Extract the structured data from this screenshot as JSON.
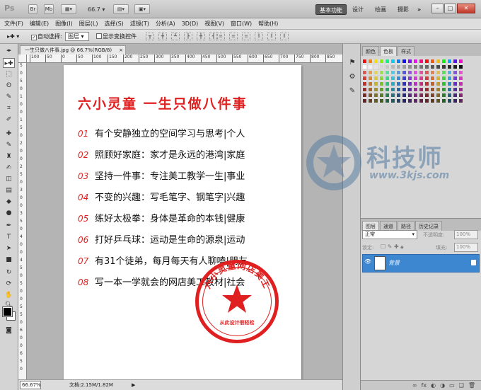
{
  "titlebar": {
    "app_logo": "Ps",
    "zoom_value": "66.7",
    "workspaces": [
      "基本功能",
      "设计",
      "绘画",
      "摄影"
    ],
    "more": "»"
  },
  "menubar": [
    "文件(F)",
    "编辑(E)",
    "图像(I)",
    "图层(L)",
    "选择(S)",
    "滤镜(T)",
    "分析(A)",
    "3D(D)",
    "视图(V)",
    "窗口(W)",
    "帮助(H)"
  ],
  "options": {
    "auto_select_label": "自动选择:",
    "auto_select_value": "图层",
    "show_transform_label": "显示变换控件"
  },
  "document": {
    "tab_title": "一生只做八件事.jpg @ 66.7%(RGB/8)",
    "tab_close": "×",
    "ruler_h": [
      "100",
      "50",
      "0",
      "50",
      "100",
      "150",
      "200",
      "250",
      "300",
      "350",
      "400",
      "450",
      "500",
      "550",
      "600",
      "650",
      "700",
      "750",
      "800",
      "850"
    ],
    "ruler_v": [
      "5",
      "0",
      "5",
      "0",
      "1",
      "0",
      "0",
      "1",
      "5",
      "0",
      "2",
      "0",
      "0",
      "2",
      "5",
      "0",
      "3",
      "0",
      "0",
      "3",
      "5",
      "0",
      "4",
      "0",
      "0",
      "4",
      "5",
      "0",
      "5",
      "0",
      "0",
      "5",
      "5",
      "0",
      "6",
      "0",
      "0",
      "6",
      "5",
      "0"
    ],
    "headline": "六小灵童 一生只做八件事",
    "rules": [
      {
        "num": "01",
        "text": "有个安静独立的空间学习与思考|个人"
      },
      {
        "num": "02",
        "text": "照顾好家庭：家才是永远的港湾|家庭"
      },
      {
        "num": "03",
        "text": "坚持一件事：专注美工教学一生|事业"
      },
      {
        "num": "04",
        "text": "不变的兴趣：写毛笔字、钢笔字|兴趣"
      },
      {
        "num": "05",
        "text": "练好太极拳：身体是革命的本钱|健康"
      },
      {
        "num": "06",
        "text": "打好乒乓球：运动是生命的源泉|运动"
      },
      {
        "num": "07",
        "text": "有31个徒弟，每月每天有人聊嗑|朋友"
      },
      {
        "num": "08",
        "text": "写一本一学就会的网店美工教材|社会"
      }
    ],
    "stamp_top_text": "六小灵童网店美工",
    "stamp_bottom_text": "从此设计很轻松",
    "stamp_color": "#e02020"
  },
  "statusbar": {
    "zoom": "66.67%",
    "doc_info": "文档:2.15M/1.82M",
    "arrow": "▶"
  },
  "panels": {
    "swatch_tabs": [
      "颜色",
      "色板",
      "样式"
    ],
    "layer_tabs": [
      "图层",
      "通道",
      "路径",
      "历史记录"
    ],
    "blend_mode": "正常",
    "opacity_label": "不透明度:",
    "opacity_value": "100%",
    "lock_label": "锁定:",
    "fill_label": "填充:",
    "fill_value": "100%",
    "layer_name": "背景"
  },
  "watermark": {
    "text": "科技师",
    "url": "www.3kjs.com"
  }
}
